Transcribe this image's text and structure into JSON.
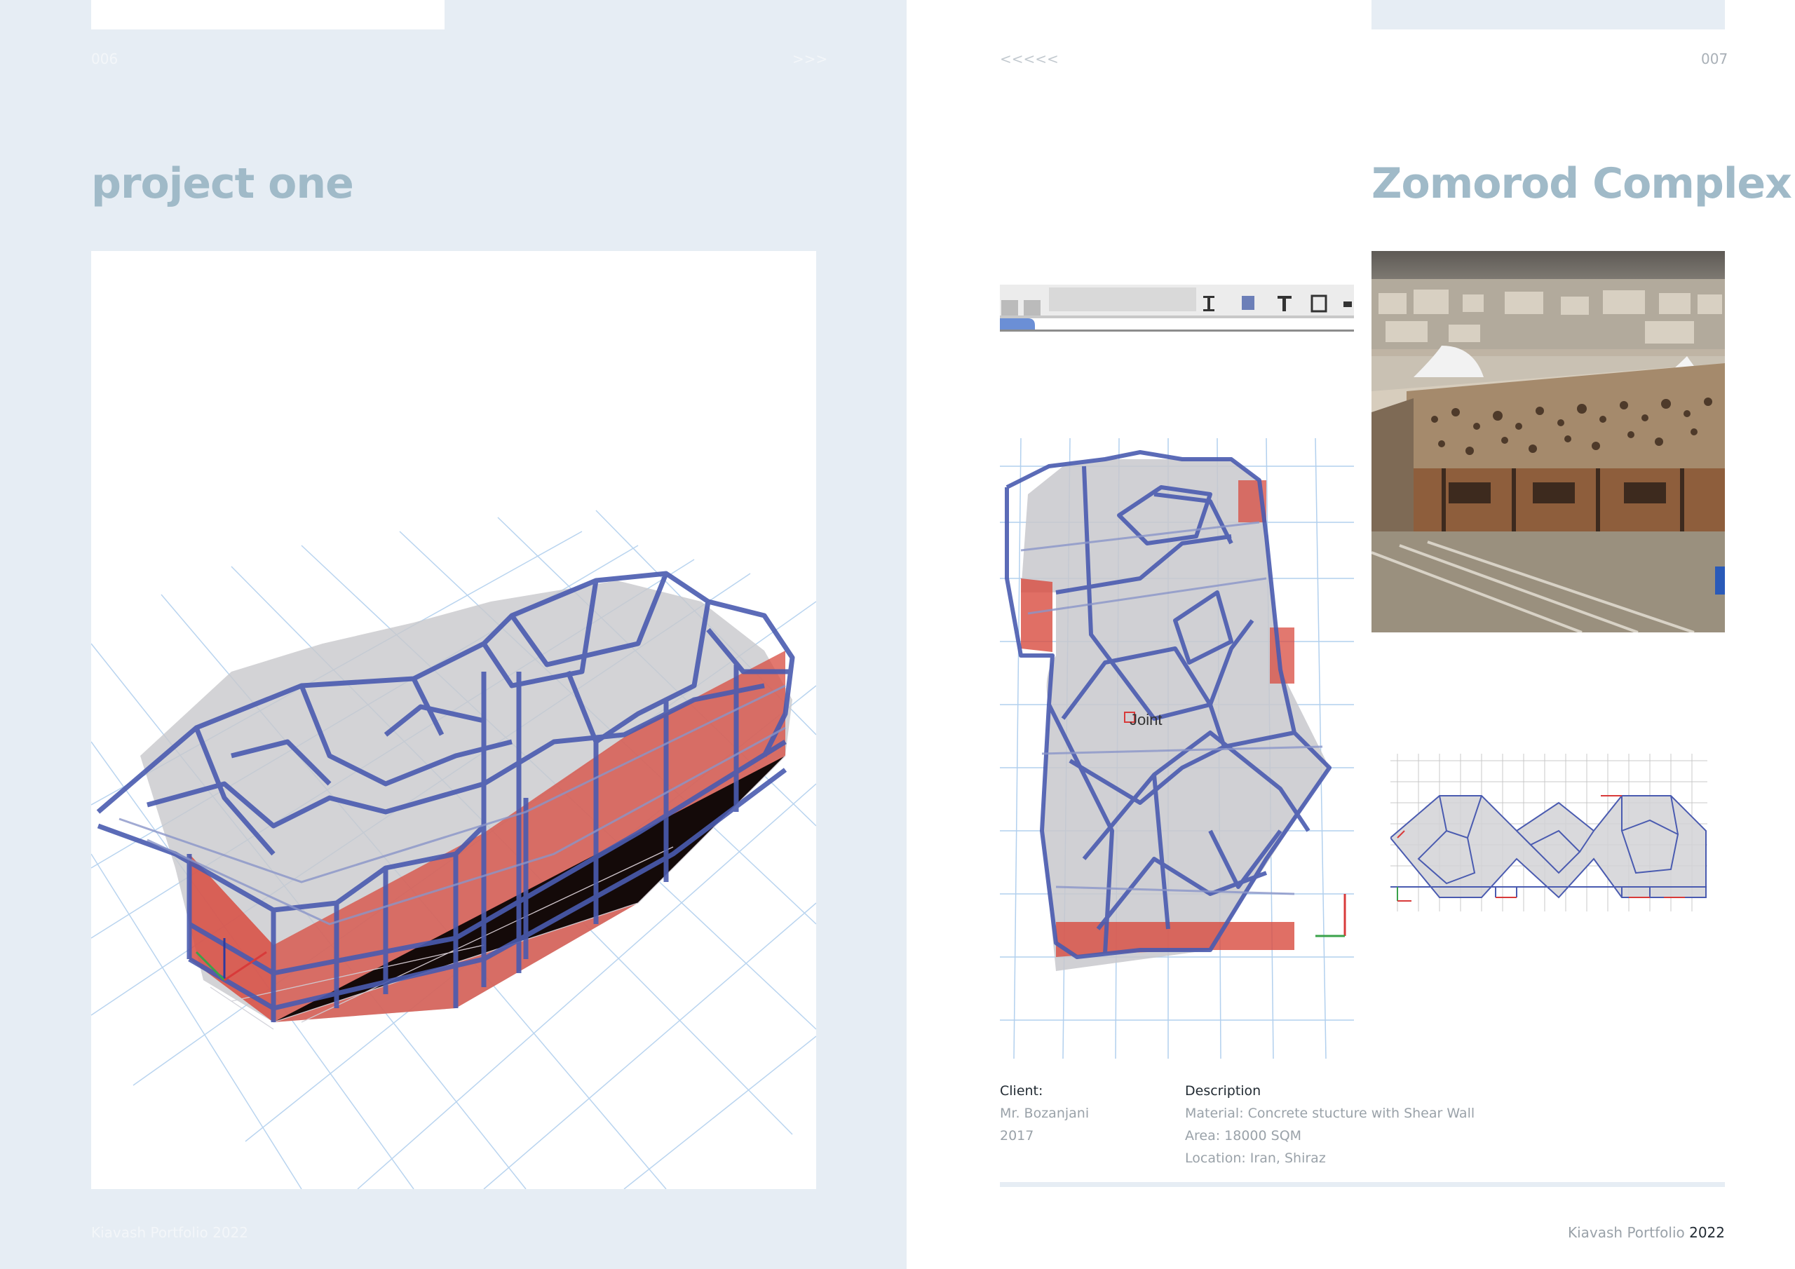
{
  "left_page": {
    "page_number": "006",
    "nav_next": ">>>",
    "title": "project one",
    "footer": "Kiavash Portfolio 2022"
  },
  "right_page": {
    "nav_prev": "<<<<<",
    "page_number": "007",
    "title": "Zomorod Complex",
    "model_label": "Joint",
    "client": {
      "label": "Client:",
      "name": "Mr. Bozanjani",
      "year": "2017"
    },
    "description": {
      "label": "Description",
      "material": "Material: Concrete stucture with Shear Wall",
      "area": "Area: 18000 SQM",
      "location": "Location: Iran, Shiraz"
    },
    "footer_text": "Kiavash Portfolio",
    "footer_year": "2022"
  },
  "colors": {
    "left_background": "#e6edf4",
    "title_color": "#a0bac8",
    "frame_blue": "#4a5bb0",
    "wall_red": "#d84b3f",
    "grid_blue": "#a8c8e8"
  }
}
